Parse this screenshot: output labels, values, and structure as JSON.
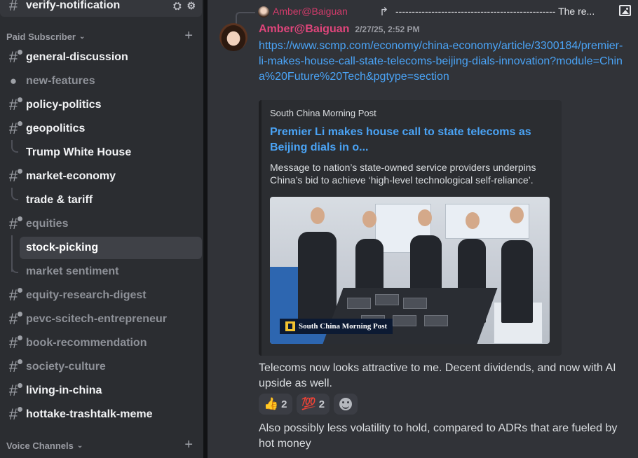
{
  "sidebar": {
    "top_channel": "verify-notification",
    "category_paid": "Paid Subscriber",
    "category_voice": "Voice Channels",
    "channels": [
      {
        "label": "general-discussion"
      },
      {
        "label": "new-features"
      },
      {
        "label": "policy-politics"
      },
      {
        "label": "geopolitics"
      },
      {
        "label": "Trump White House"
      },
      {
        "label": "market-economy"
      },
      {
        "label": "trade & tariff"
      },
      {
        "label": "equities"
      },
      {
        "label": "stock-picking"
      },
      {
        "label": "market sentiment"
      },
      {
        "label": "equity-research-digest"
      },
      {
        "label": "pevc-scitech-entrepreneur"
      },
      {
        "label": "book-recommendation"
      },
      {
        "label": "society-culture"
      },
      {
        "label": "living-in-china"
      },
      {
        "label": "hottake-trashtalk-meme"
      }
    ]
  },
  "reply": {
    "author": "Amber@Baiguan",
    "text": "------------------------------------------------- The re..."
  },
  "message": {
    "author": "Amber@Baiguan",
    "timestamp": "2/27/25, 2:52 PM",
    "link": "https://www.scmp.com/economy/china-economy/article/3300184/premier-li-makes-house-call-state-telecoms-beijing-dials-innovation?module=China%20Future%20Tech&pgtype=section",
    "embed": {
      "provider": "South China Morning Post",
      "title": "Premier Li makes house call to state telecoms as Beijing dials in o...",
      "description": "Message to nation’s state-owned service providers underpins China’s bid to achieve ‘high-level technological self-reliance’.",
      "image_logo": "South China Morning Post"
    },
    "body1": "Telecoms now looks attractive to me. Decent dividends, and now with AI upside as well.",
    "reactions": [
      {
        "emoji": "👍",
        "count": "2"
      },
      {
        "emoji": "💯",
        "count": "2"
      }
    ],
    "body2": "Also possibly less volatility to hold, compared to ADRs that are fueled by hot money"
  }
}
